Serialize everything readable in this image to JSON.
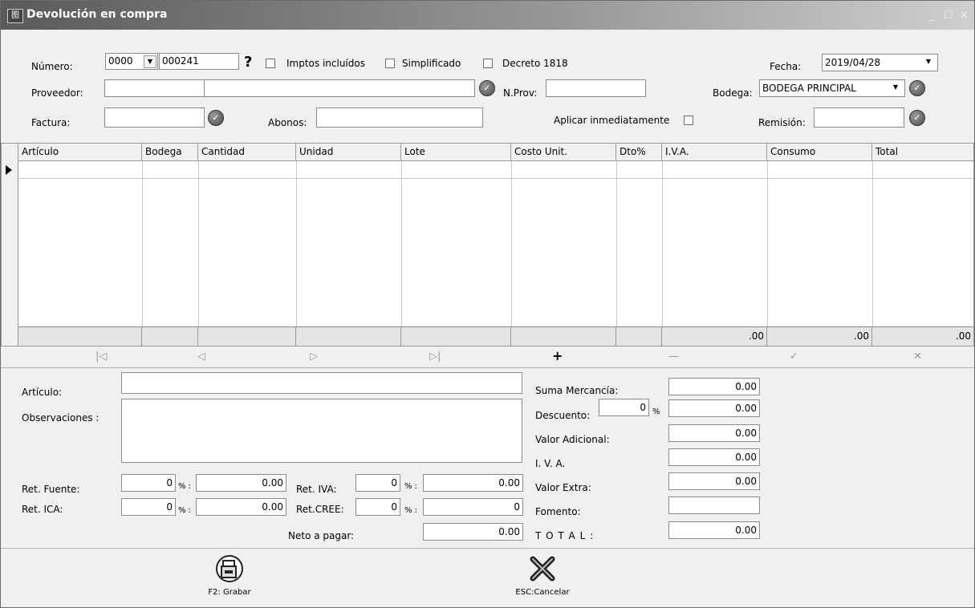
{
  "window": {
    "title": "Devolución en compra",
    "icon_text": "图"
  },
  "header": {
    "numero_label": "Número:",
    "numero_prefix": "0000",
    "numero_value": "000241",
    "help_glyph": "?",
    "imptos_label": "Imptos incluídos",
    "simplificado_label": "Simplificado",
    "decreto_label": "Decreto 1818",
    "fecha_label": "Fecha:",
    "fecha_value": "2019/04/28",
    "proveedor_label": "Proveedor:",
    "proveedor_code": "",
    "proveedor_name": "",
    "nprov_label": "N.Prov:",
    "nprov_value": "",
    "bodega_label": "Bodega:",
    "bodega_value": "BODEGA PRINCIPAL",
    "factura_label": "Factura:",
    "factura_value": "",
    "abonos_label": "Abonos:",
    "abonos_value": "",
    "aplicar_label": "Aplicar inmediatamente",
    "remision_label": "Remisión:",
    "remision_value": ""
  },
  "grid": {
    "columns": [
      "Artículo",
      "Bodega",
      "Cantidad",
      "Unidad",
      "Lote",
      "Costo Unit.",
      "Dto%",
      "I.V.A.",
      "Consumo",
      "Total"
    ],
    "footer": [
      "",
      "",
      "",
      "",
      "",
      "",
      "",
      ".00",
      ".00",
      ".00"
    ]
  },
  "nav": {
    "first": "|◁",
    "prev": "◁",
    "next": "▷",
    "last": "▷|",
    "add": "+",
    "minus": "—",
    "check": "✓",
    "cancel": "✕"
  },
  "bottom": {
    "articulo_label": "Artículo:",
    "articulo_value": "",
    "observaciones_label": "Observaciones :",
    "observaciones_value": "",
    "ret_fuente_label": "Ret. Fuente:",
    "ret_fuente_pct": "0",
    "ret_fuente_val": "0.00",
    "ret_ica_label": "Ret. ICA:",
    "ret_ica_pct": "0",
    "ret_ica_val": "0.00",
    "ret_iva_label": "Ret. IVA:",
    "ret_iva_pct": "0",
    "ret_iva_val": "0.00",
    "ret_cree_label": "Ret.CREE:",
    "ret_cree_pct": "0",
    "ret_cree_val": "0",
    "pct_sign": "% :",
    "neto_label": "Neto a pagar:",
    "neto_value": "0.00"
  },
  "totals": {
    "suma_label": "Suma Mercancía:",
    "suma_value": "0.00",
    "descuento_label": "Descuento:",
    "descuento_pct": "0",
    "descuento_pct_sign": "%",
    "descuento_value": "0.00",
    "valor_adicional_label": "Valor Adicional:",
    "valor_adicional_value": "0.00",
    "iva_label": "I. V. A.",
    "iva_value": "0.00",
    "valor_extra_label": "Valor Extra:",
    "valor_extra_value": "0.00",
    "fomento_label": "Fomento:",
    "fomento_value": "",
    "total_label": "T O T A L :",
    "total_value": "0.00"
  },
  "footer_buttons": {
    "save_label": "F2: Grabar",
    "cancel_label": "ESC:Cancelar"
  }
}
